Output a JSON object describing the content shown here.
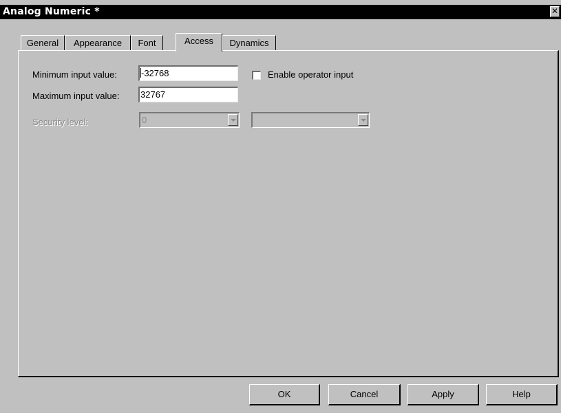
{
  "window": {
    "title": "Analog Numeric *",
    "close_glyph": "✕"
  },
  "tabs": [
    {
      "label": "General"
    },
    {
      "label": "Appearance"
    },
    {
      "label": "Font"
    },
    {
      "label": "Access",
      "active": true
    },
    {
      "label": "Dynamics"
    }
  ],
  "access": {
    "min_label": "Minimum input value:",
    "min_value": "-32768",
    "max_label": "Maximum input value:",
    "max_value": "32767",
    "enable_operator_label": "Enable operator input",
    "enable_operator_checked": false,
    "security_label": "Security level:",
    "security_value": "0",
    "security_second_value": ""
  },
  "buttons": {
    "ok": "OK",
    "cancel": "Cancel",
    "apply": "Apply",
    "help": "Help"
  }
}
